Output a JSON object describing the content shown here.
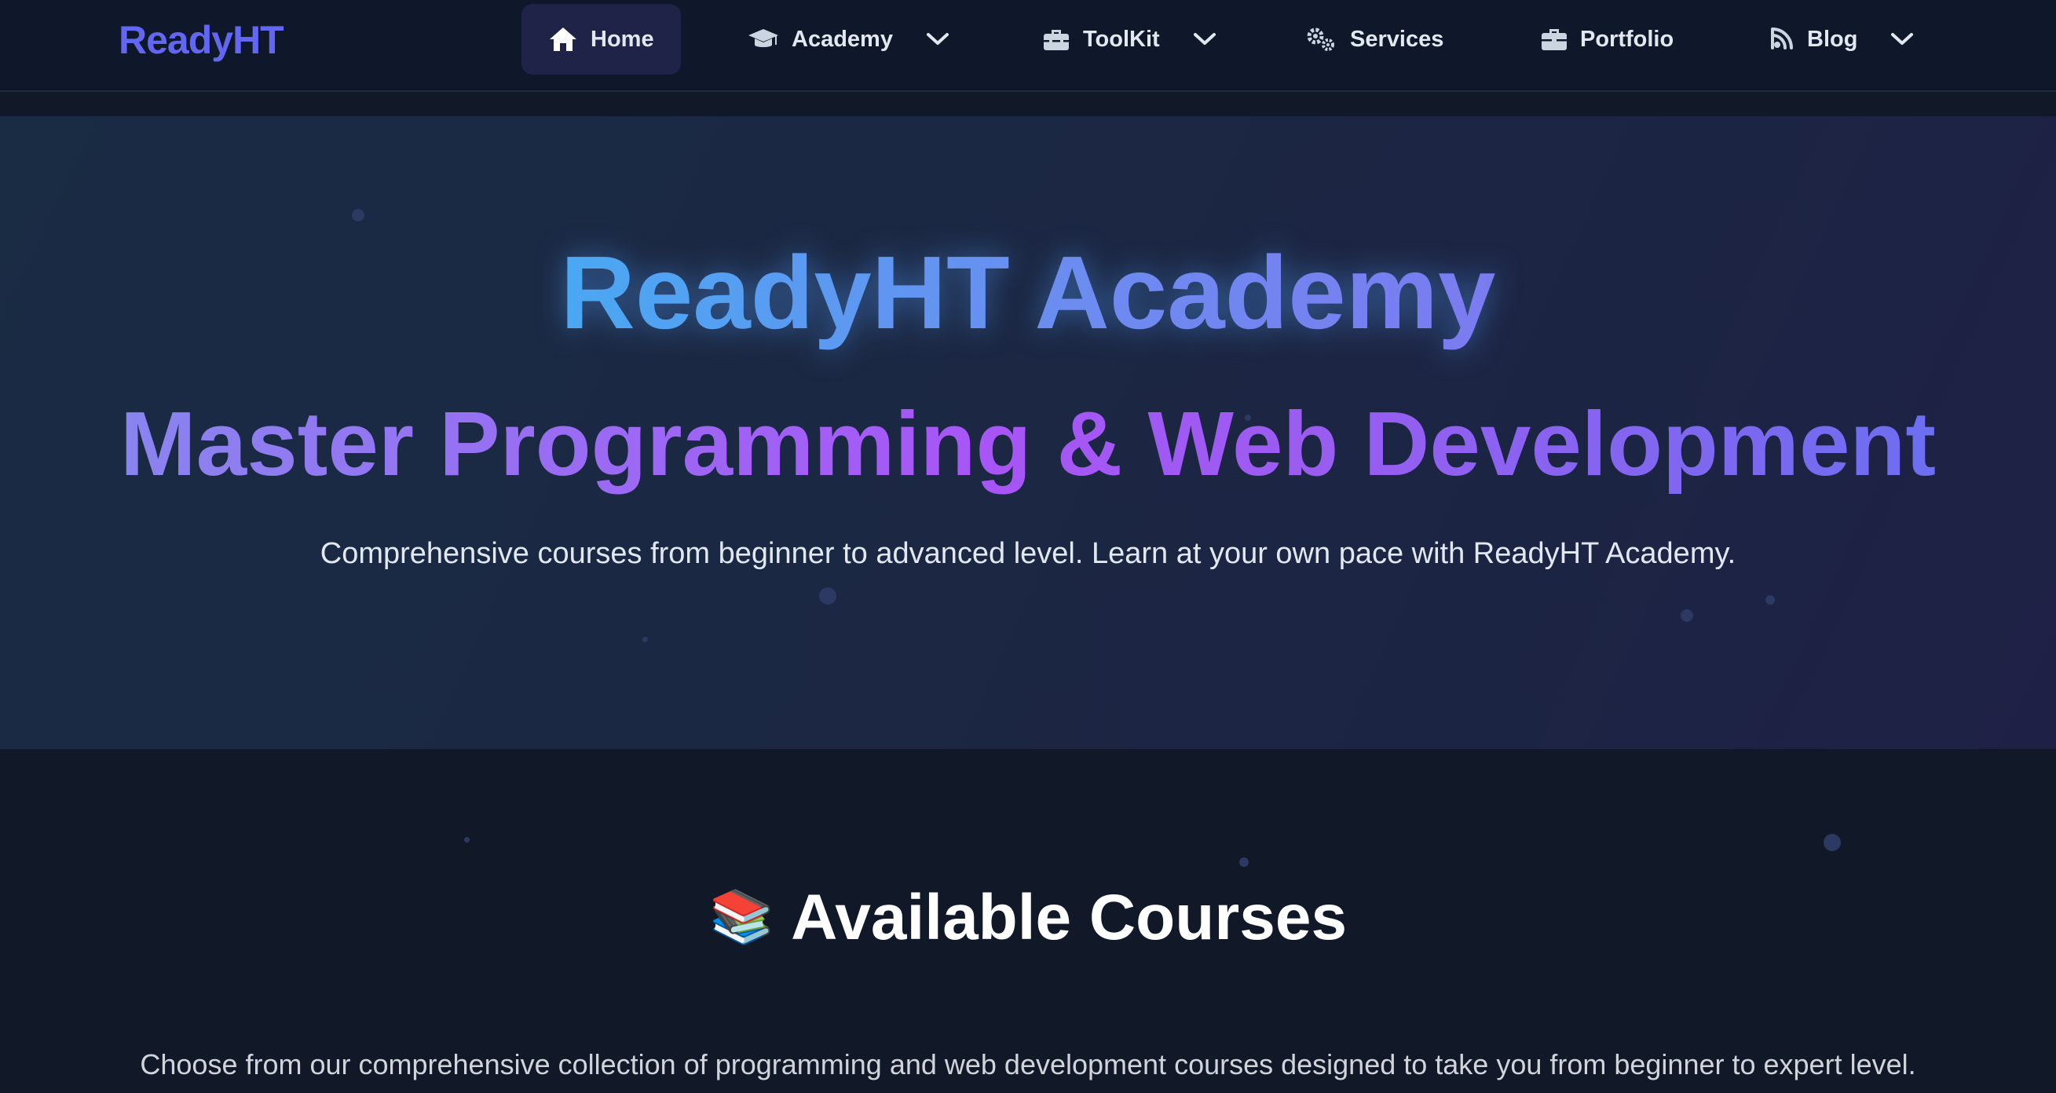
{
  "brand": {
    "name": "ReadyHT",
    "color": "#6366f1"
  },
  "nav": {
    "items": [
      {
        "label": "Home",
        "icon": "home-icon",
        "active": true,
        "dropdown": false
      },
      {
        "label": "Academy",
        "icon": "graduation-cap-icon",
        "active": false,
        "dropdown": true
      },
      {
        "label": "ToolKit",
        "icon": "toolbox-icon",
        "active": false,
        "dropdown": true
      },
      {
        "label": "Services",
        "icon": "gears-icon",
        "active": false,
        "dropdown": false
      },
      {
        "label": "Portfolio",
        "icon": "briefcase-icon",
        "active": false,
        "dropdown": false
      },
      {
        "label": "Blog",
        "icon": "rss-icon",
        "active": false,
        "dropdown": true
      }
    ]
  },
  "hero": {
    "title": "ReadyHT Academy",
    "subtitle": "Master Programming & Web Development",
    "description": "Comprehensive courses from beginner to advanced level. Learn at your own pace with ReadyHT Academy."
  },
  "courses": {
    "icon": "books-icon",
    "emoji": "📚",
    "title": "Available Courses",
    "description": "Choose from our comprehensive collection of programming and web development courses designed to take you from beginner to expert level."
  },
  "colors": {
    "background": "#111827",
    "navbar": "#0f172a",
    "active_nav": "#1e2347",
    "hero_title_gradient": [
      "#4aa8f2",
      "#7b7bf0"
    ],
    "hero_subtitle_gradient": [
      "#8a84ef",
      "#a855f7",
      "#6d6ef0"
    ]
  }
}
